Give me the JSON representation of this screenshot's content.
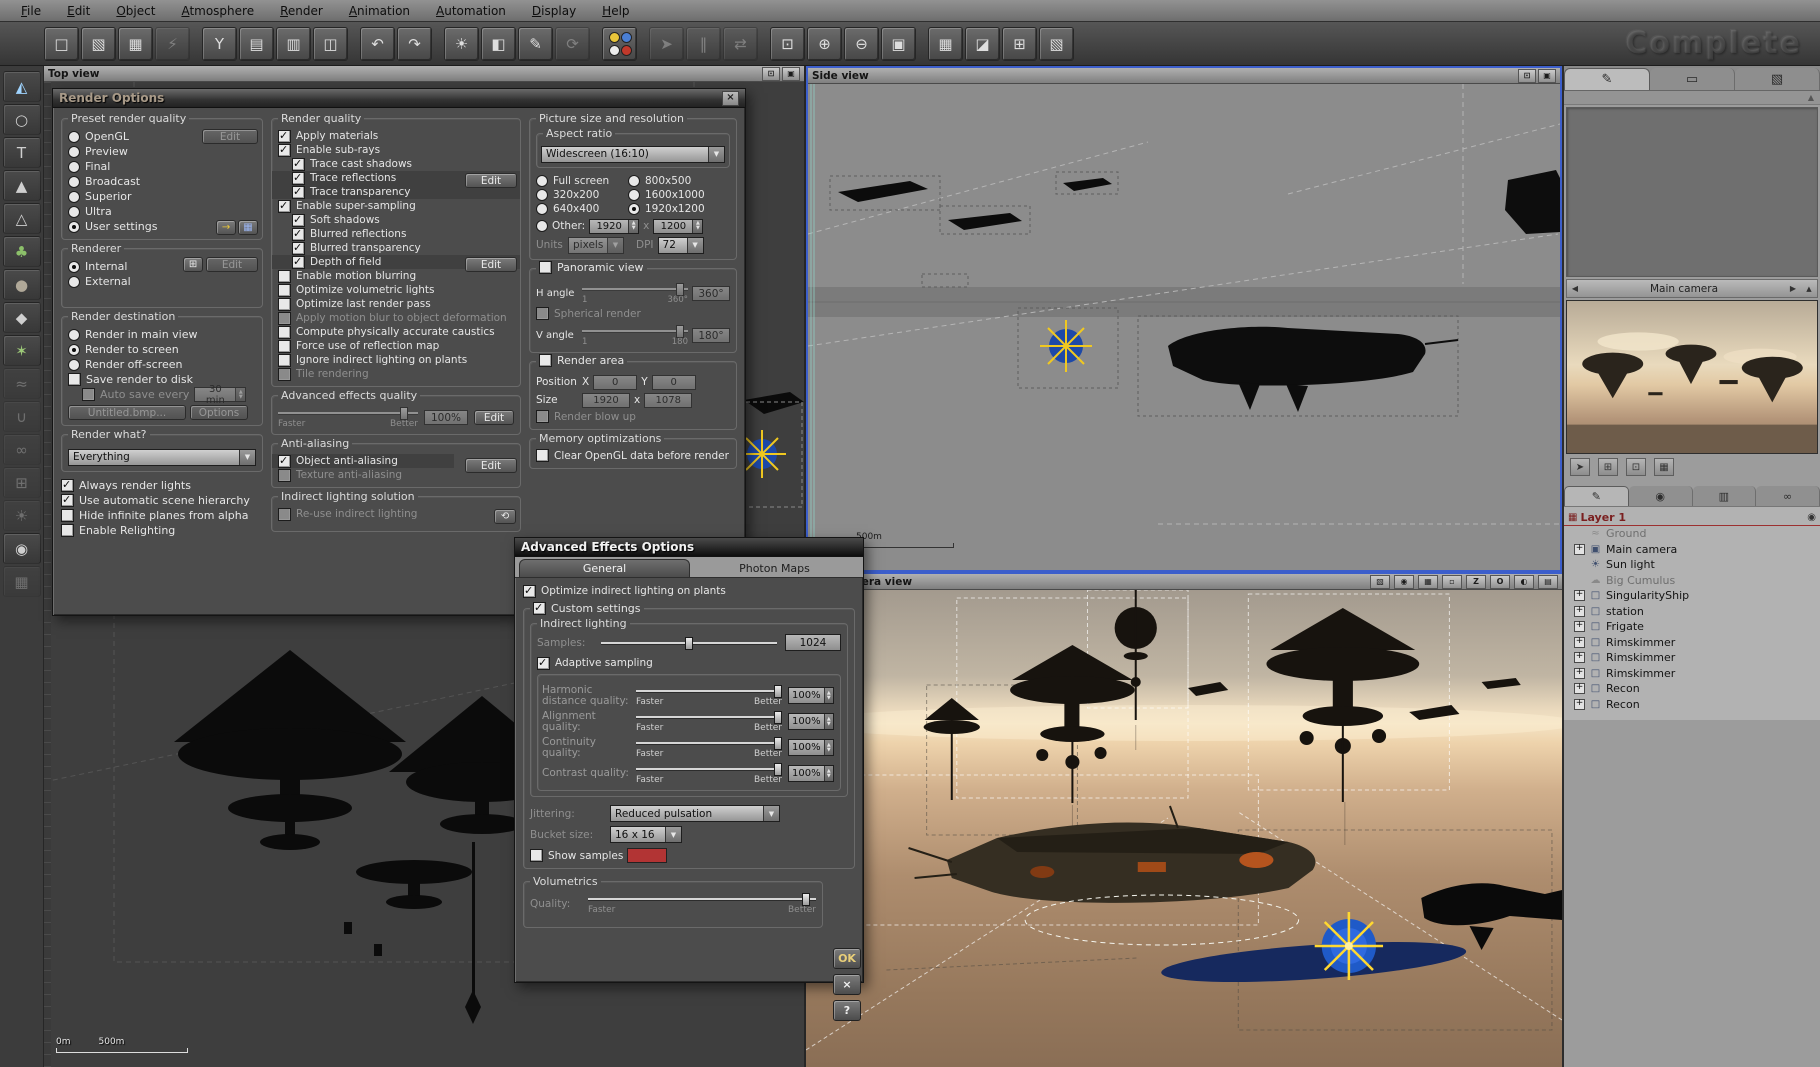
{
  "app": {
    "watermark": "Complete"
  },
  "menubar": {
    "items": [
      {
        "label": "File"
      },
      {
        "label": "Edit"
      },
      {
        "label": "Object"
      },
      {
        "label": "Atmosphere"
      },
      {
        "label": "Render"
      },
      {
        "label": "Animation"
      },
      {
        "label": "Automation"
      },
      {
        "label": "Display"
      },
      {
        "label": "Help"
      }
    ]
  },
  "toolbar": {
    "palette_colors": [
      "#e8c53a",
      "#4a7fd4",
      "#ececec",
      "#c0392b"
    ],
    "groups": [
      {
        "icons": [
          {
            "name": "new-scene-icon",
            "glyph": "□"
          },
          {
            "name": "open-file-icon",
            "glyph": "▧"
          },
          {
            "name": "save-file-icon",
            "glyph": "▦"
          },
          {
            "name": "render-flash-icon",
            "glyph": "⚡",
            "dim": true
          }
        ]
      },
      {
        "icons": [
          {
            "name": "merge-objects-icon",
            "glyph": "Y"
          },
          {
            "name": "object-list-icon",
            "glyph": "▤"
          },
          {
            "name": "copy-objects-icon",
            "glyph": "▥"
          },
          {
            "name": "paste-objects-icon",
            "glyph": "◫"
          }
        ]
      },
      {
        "icons": [
          {
            "name": "undo-icon",
            "glyph": "↶"
          },
          {
            "name": "redo-icon",
            "glyph": "↷"
          }
        ]
      },
      {
        "icons": [
          {
            "name": "atmosphere-editor-icon",
            "glyph": "☀"
          },
          {
            "name": "object-editor-icon",
            "glyph": "◧"
          },
          {
            "name": "material-editor-icon",
            "glyph": "✎"
          },
          {
            "name": "rotate-tool-icon",
            "glyph": "⟳",
            "dim": true
          }
        ]
      },
      {
        "icons": [
          {
            "name": "color-palette-icon",
            "glyph": ""
          }
        ]
      },
      {
        "icons": [
          {
            "name": "select-pointer-icon",
            "glyph": "➤",
            "dim": true
          },
          {
            "name": "align-bars-icon",
            "glyph": "‖",
            "dim": true
          },
          {
            "name": "mirror-icon",
            "glyph": "⇄",
            "dim": true
          }
        ]
      },
      {
        "icons": [
          {
            "name": "zoom-region-icon",
            "glyph": "⊡"
          },
          {
            "name": "zoom-in-icon",
            "glyph": "⊕"
          },
          {
            "name": "zoom-out-icon",
            "glyph": "⊖"
          },
          {
            "name": "zoom-fit-icon",
            "glyph": "▣"
          }
        ]
      },
      {
        "icons": [
          {
            "name": "render-animation-icon",
            "glyph": "▦"
          },
          {
            "name": "clapperboard-icon",
            "glyph": "◪"
          },
          {
            "name": "render-frame-icon",
            "glyph": "⊞"
          },
          {
            "name": "camera-manager-icon",
            "glyph": "▧"
          }
        ]
      }
    ]
  },
  "left_toolbar": {
    "tools": [
      {
        "name": "terrain-tool-icon",
        "glyph": "◭",
        "color": "#9fd4ff"
      },
      {
        "name": "sphere-primitive-icon",
        "glyph": "○"
      },
      {
        "name": "text-object-icon",
        "glyph": "T"
      },
      {
        "name": "mountain-tool-icon",
        "glyph": "▲"
      },
      {
        "name": "mountain-edit-icon",
        "glyph": "△"
      },
      {
        "name": "tree-tool-icon",
        "glyph": "♣",
        "color": "#8cc06a"
      },
      {
        "name": "rock-tool-icon",
        "glyph": "●",
        "color": "#b0a898"
      },
      {
        "name": "cone-primitive-icon",
        "glyph": "◆"
      },
      {
        "name": "plant-tool-icon",
        "glyph": "✶",
        "color": "#9cc878"
      },
      {
        "name": "water-tool-icon",
        "glyph": "≈",
        "dim": true
      },
      {
        "name": "magnet-tool-icon",
        "glyph": "∪",
        "dim": true
      },
      {
        "name": "link-tool-icon",
        "glyph": "∞",
        "dim": true
      },
      {
        "name": "array-tool-icon",
        "glyph": "⊞",
        "dim": true
      },
      {
        "name": "light-tool-icon",
        "glyph": "☀",
        "dim": true
      },
      {
        "name": "camera-tool-icon",
        "glyph": "◉"
      },
      {
        "name": "helper-tool-icon",
        "glyph": "▦",
        "dim": true
      }
    ]
  },
  "viewports": {
    "top": {
      "title": "Top view",
      "scale_zero": "0m",
      "scale_label": "500m",
      "icons": [
        {
          "name": "maximize-view-icon",
          "glyph": "⊡"
        },
        {
          "name": "view-options-icon",
          "glyph": "▣"
        }
      ]
    },
    "side": {
      "title": "Side view",
      "scale_label": "500m",
      "icons": [
        {
          "name": "maximize-view-icon",
          "glyph": "⊡"
        },
        {
          "name": "view-options-icon",
          "glyph": "▣"
        }
      ]
    },
    "camera": {
      "title": "Camera view",
      "icons": [
        {
          "name": "wireframe-mode-icon",
          "glyph": "▧"
        },
        {
          "name": "shaded-mode-icon",
          "glyph": "◉"
        },
        {
          "name": "rgb-display-icon",
          "glyph": "▦"
        },
        {
          "name": "point-display-icon",
          "glyph": "▫"
        },
        {
          "name": "zbuffer-display-icon",
          "glyph": "Z"
        },
        {
          "name": "outline-display-icon",
          "glyph": "O"
        },
        {
          "name": "contrast-display-icon",
          "glyph": "◐"
        },
        {
          "name": "save-view-icon",
          "glyph": "▤"
        }
      ]
    }
  },
  "sidebar": {
    "tabs": [
      {
        "name": "edit-tab",
        "glyph": "✎",
        "active": true
      },
      {
        "name": "measure-tab",
        "glyph": "▭"
      },
      {
        "name": "library-tab",
        "glyph": "▧"
      }
    ],
    "camera_bar": {
      "prev_glyph": "◀",
      "label": "Main camera",
      "next_glyph": "▶",
      "collapse_glyph": "▲"
    },
    "preview_buttons": [
      {
        "name": "pan-preview-icon",
        "glyph": "➤"
      },
      {
        "name": "quad-view-icon",
        "glyph": "⊞"
      },
      {
        "name": "fullscreen-preview-icon",
        "glyph": "⊡"
      },
      {
        "name": "save-preview-icon",
        "glyph": "▦"
      }
    ],
    "aspect_tabs": [
      {
        "name": "aspect-tab",
        "glyph": "✎",
        "active": true
      },
      {
        "name": "visibility-tab",
        "glyph": "◉"
      },
      {
        "name": "numerics-tab",
        "glyph": "▥"
      },
      {
        "name": "links-tab",
        "glyph": "∞"
      }
    ],
    "layers": {
      "header": "Layer 1",
      "folder_glyph": "▦",
      "eye_glyph": "◉",
      "expand_glyph": "+",
      "items": [
        {
          "label": "Ground",
          "glyph": "≈",
          "dim": true
        },
        {
          "label": "Main camera",
          "glyph": "▣",
          "expandable": true
        },
        {
          "label": "Sun light",
          "glyph": "☀"
        },
        {
          "label": "Big Cumulus",
          "glyph": "☁",
          "dim": true
        },
        {
          "label": "SingularityShip",
          "glyph": "□",
          "expandable": true
        },
        {
          "label": "station",
          "glyph": "□",
          "expandable": true
        },
        {
          "label": "Frigate",
          "glyph": "□",
          "expandable": true
        },
        {
          "label": "Rimskimmer",
          "glyph": "□",
          "expandable": true
        },
        {
          "label": "Rimskimmer",
          "glyph": "□",
          "expandable": true
        },
        {
          "label": "Rimskimmer",
          "glyph": "□",
          "expandable": true
        },
        {
          "label": "Recon",
          "glyph": "□",
          "expandable": true
        },
        {
          "label": "Recon",
          "glyph": "□",
          "expandable": true
        }
      ]
    }
  },
  "render_options": {
    "title": "Render Options",
    "close_glyph": "×",
    "preset": {
      "legend": "Preset render quality",
      "edit_label": "Edit",
      "apply_glyph": "→",
      "save_glyph": "▦",
      "options": [
        {
          "label": "OpenGL"
        },
        {
          "label": "Preview"
        },
        {
          "label": "Final"
        },
        {
          "label": "Broadcast"
        },
        {
          "label": "Superior"
        },
        {
          "label": "Ultra"
        },
        {
          "label": "User settings",
          "selected": true
        }
      ]
    },
    "renderer": {
      "legend": "Renderer",
      "edit_label": "Edit",
      "network_glyph": "⊞",
      "options": [
        {
          "label": "Internal",
          "selected": true
        },
        {
          "label": "External"
        }
      ]
    },
    "destination": {
      "legend": "Render destination",
      "options": [
        {
          "label": "Render in main view"
        },
        {
          "label": "Render to screen",
          "selected": true
        },
        {
          "label": "Render off-screen"
        }
      ],
      "save_label": "Save render to disk",
      "autosave_label": "Auto save every",
      "autosave_value": "30 min",
      "file_label": "Untitled.bmp...",
      "options_label": "Options"
    },
    "render_what": {
      "legend": "Render what?",
      "value": "Everything"
    },
    "flags": [
      {
        "label": "Always render lights",
        "checked": true
      },
      {
        "label": "Use automatic scene hierarchy",
        "checked": true
      },
      {
        "label": "Hide infinite planes from alpha"
      },
      {
        "label": "Enable Relighting"
      }
    ],
    "quality": {
      "legend": "Render quality",
      "edit_label": "Edit",
      "items": [
        {
          "label": "Apply materials",
          "checked": true
        },
        {
          "label": "Enable sub-rays",
          "checked": true
        },
        {
          "label": "Trace cast shadows",
          "checked": true,
          "indent": true
        },
        {
          "label": "Trace reflections",
          "checked": true,
          "indent": true,
          "stripe": true
        },
        {
          "label": "Trace transparency",
          "checked": true,
          "indent": true,
          "stripe": true
        },
        {
          "label": "Enable super-sampling",
          "checked": true
        },
        {
          "label": "Soft shadows",
          "checked": true,
          "indent": true
        },
        {
          "label": "Blurred reflections",
          "checked": true,
          "indent": true
        },
        {
          "label": "Blurred transparency",
          "checked": true,
          "indent": true
        },
        {
          "label": "Depth of field",
          "checked": true,
          "indent": true,
          "stripe": true
        },
        {
          "label": "Enable motion blurring"
        },
        {
          "label": "Optimize volumetric lights"
        },
        {
          "label": "Optimize last render pass"
        },
        {
          "label": "Apply motion blur to object deformation",
          "disabled": true
        },
        {
          "label": "Compute physically accurate caustics"
        },
        {
          "label": "Force use of reflection map"
        },
        {
          "label": "Ignore indirect lighting on plants"
        },
        {
          "label": "Tile rendering",
          "disabled": true
        }
      ]
    },
    "adv_quality": {
      "legend": "Advanced effects quality",
      "value": "100%",
      "faster": "Faster",
      "better": "Better",
      "edit_label": "Edit"
    },
    "antialiasing": {
      "legend": "Anti-aliasing",
      "edit_label": "Edit",
      "items": [
        {
          "label": "Object anti-aliasing",
          "checked": true,
          "stripe": true
        },
        {
          "label": "Texture anti-aliasing",
          "disabled": true
        }
      ]
    },
    "indirect": {
      "legend": "Indirect lighting solution",
      "reuse_label": "Re-use indirect lighting",
      "refresh_glyph": "⟲"
    },
    "picture": {
      "legend": "Picture size and resolution",
      "aspect_legend": "Aspect ratio",
      "aspect_value": "Widescreen (16:10)",
      "radios": [
        {
          "label": "Full screen"
        },
        {
          "label": "800x500"
        },
        {
          "label": "320x200"
        },
        {
          "label": "1600x1000"
        },
        {
          "label": "640x400"
        },
        {
          "label": "1920x1200",
          "selected": true
        }
      ],
      "other_label": "Other:",
      "other_w": "1920",
      "times": "x",
      "other_h": "1200",
      "units_label": "Units",
      "units_value": "pixels",
      "dpi_label": "DPI",
      "dpi_value": "72"
    },
    "panoramic": {
      "label": "Panoramic view",
      "h_label": "H angle",
      "h_value": "360°",
      "h_min": "1",
      "h_max": "360°",
      "spherical_label": "Spherical render",
      "v_label": "V angle",
      "v_value": "180°",
      "v_min": "1",
      "v_max": "180"
    },
    "render_area": {
      "label": "Render area",
      "position_label": "Position",
      "x_label": "X",
      "pos_x": "0",
      "y_label": "Y",
      "pos_y": "0",
      "size_label": "Size",
      "size_w": "1920",
      "times": "x",
      "size_h": "1078",
      "blowup_label": "Render blow up"
    },
    "memory": {
      "legend": "Memory optimizations",
      "clear_label": "Clear OpenGL data before render"
    }
  },
  "advanced_effects": {
    "title": "Advanced Effects Options",
    "tabs": [
      {
        "label": "General",
        "active": true
      },
      {
        "label": "Photon Maps"
      }
    ],
    "optimize_label": "Optimize indirect lighting on plants",
    "custom_label": "Custom settings",
    "indirect_legend": "Indirect lighting",
    "samples_label": "Samples:",
    "samples_value": "1024",
    "adaptive_label": "Adaptive sampling",
    "faster": "Faster",
    "better": "Better",
    "sliders": [
      {
        "label": "Harmonic distance quality:",
        "value": "100%"
      },
      {
        "label": "Alignment quality:",
        "value": "100%"
      },
      {
        "label": "Continuity quality:",
        "value": "100%"
      },
      {
        "label": "Contrast quality:",
        "value": "100%"
      }
    ],
    "jittering_label": "Jittering:",
    "jittering_value": "Reduced pulsation",
    "bucket_label": "Bucket size:",
    "bucket_value": "16 x 16",
    "show_samples_label": "Show samples",
    "sample_color": "#b23434",
    "volumetrics_legend": "Volumetrics",
    "quality_label": "Quality:",
    "ok_label": "OK",
    "close_glyph": "×",
    "help_label": "?"
  }
}
